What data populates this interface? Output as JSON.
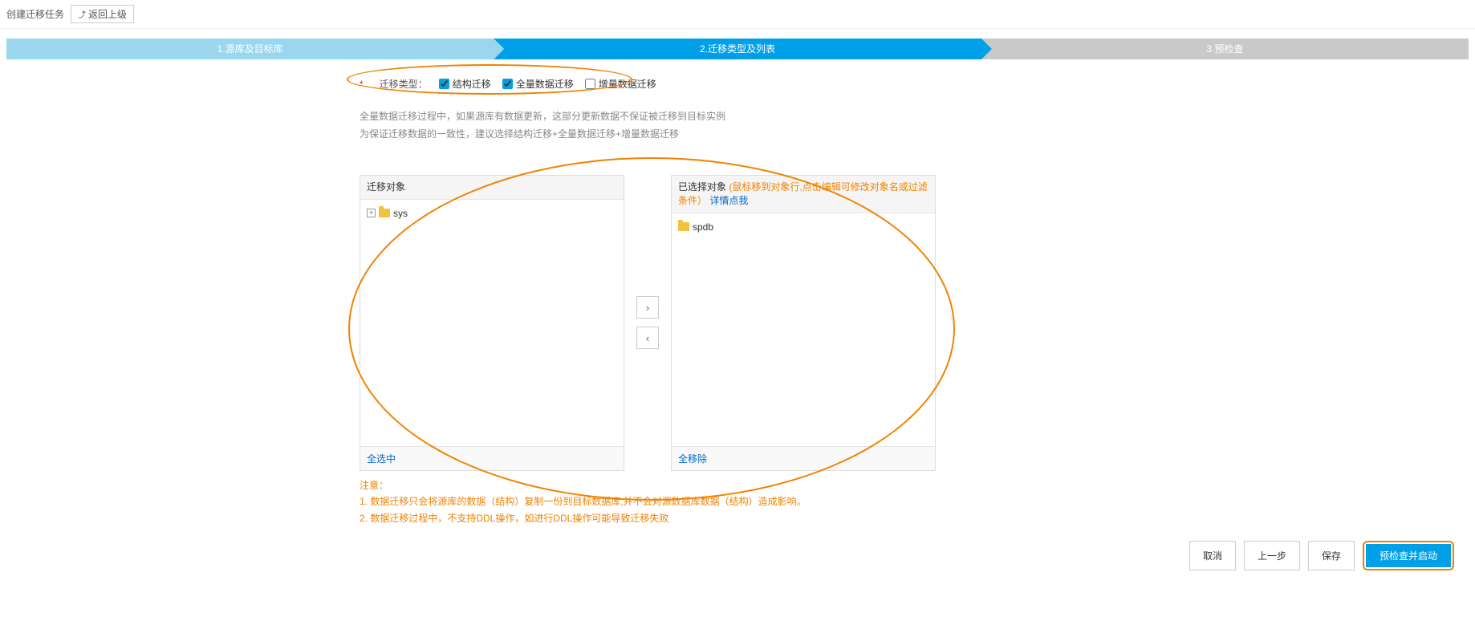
{
  "header": {
    "title": "创建迁移任务",
    "back": "返回上级"
  },
  "steps": {
    "s1": "1.源库及目标库",
    "s2": "2.迁移类型及列表",
    "s3": "3.预检查"
  },
  "type": {
    "label": "迁移类型：",
    "opt1": "结构迁移",
    "opt2": "全量数据迁移",
    "opt3": "增量数据迁移",
    "checked": {
      "opt1": true,
      "opt2": true,
      "opt3": false
    }
  },
  "hint": {
    "l1": "全量数据迁移过程中，如果源库有数据更新，这部分更新数据不保证被迁移到目标实例",
    "l2": "为保证迁移数据的一致性，建议选择结构迁移+全量数据迁移+增量数据迁移"
  },
  "left": {
    "title": "迁移对象",
    "items": [
      "sys"
    ],
    "foot": "全选中"
  },
  "right": {
    "title": "已选择对象",
    "hint": "(鼠标移到对象行,点击编辑可修改对象名或过滤条件）",
    "link": "详情点我",
    "items": [
      "spdb"
    ],
    "foot": "全移除"
  },
  "notice": {
    "title": "注意：",
    "n1": "1. 数据迁移只会将源库的数据（结构）复制一份到目标数据库,并不会对源数据库数据（结构）造成影响。",
    "n2": "2. 数据迁移过程中，不支持DDL操作，如进行DDL操作可能导致迁移失败"
  },
  "footer": {
    "cancel": "取消",
    "prev": "上一步",
    "save": "保存",
    "precheck": "预检查并启动"
  }
}
